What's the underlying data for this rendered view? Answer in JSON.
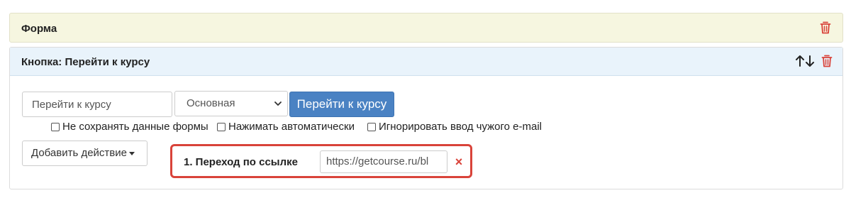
{
  "form_panel": {
    "title": "Форма",
    "delete_icon": "trash-icon",
    "accent_color": "#d9433a"
  },
  "button_panel": {
    "title": "Кнопка: Перейти к курсу",
    "move_icon": "up-down-arrows-icon",
    "delete_icon": "trash-icon",
    "name_input": {
      "value": "Перейти к курсу"
    },
    "style_select": {
      "selected": "Основная"
    },
    "preview_button": {
      "label": "Перейти к курсу",
      "color": "#4a82c3"
    },
    "options": [
      {
        "label": "Не сохранять данные формы",
        "checked": false
      },
      {
        "label": "Нажимать автоматически",
        "checked": false
      },
      {
        "label": "Игнорировать ввод чужого e-mail",
        "checked": false
      }
    ],
    "add_action": {
      "label": "Добавить действие"
    },
    "actions": [
      {
        "label": "1. Переход по ссылке",
        "url": "https://getcourse.ru/bl",
        "remove_symbol": "×"
      }
    ]
  }
}
